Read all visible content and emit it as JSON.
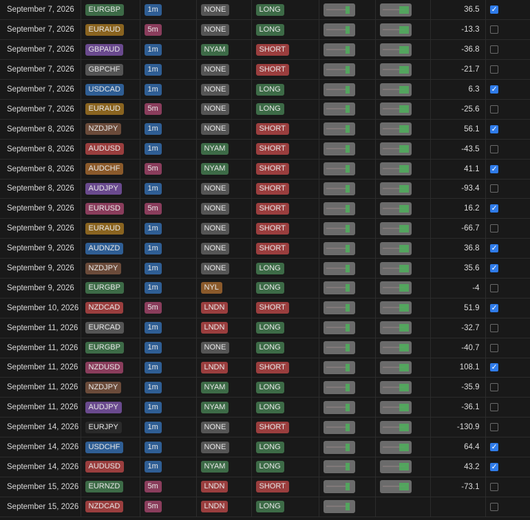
{
  "colors": {
    "EURGBP": "#3d6b47",
    "EURAUD": "#8a6420",
    "GBPAUD": "#6a4a8e",
    "GBPCHF": "#555555",
    "USDCAD": "#2f5e94",
    "NZDJPY": "#6b4b3a",
    "AUDUSD": "#9a3e3e",
    "AUDCHF": "#8b5a2b",
    "AUDJPY": "#6a4a8e",
    "EURUSD": "#8a3d5c",
    "AUDNZD": "#2f5e94",
    "NZDCAD": "#9a3e3e",
    "EURCAD": "#555555",
    "NZDUSD": "#8a3d5c",
    "EURJPY": "#2a2a2a",
    "USDCHF": "#2f5e94",
    "EURNZD": "#3d6b47",
    "1m": "#2f5e94",
    "5m": "#8a3d5c",
    "NONE": "#555555",
    "NYAM": "#3d6b47",
    "NYL": "#8b5a2b",
    "LNDN": "#9a3e3e",
    "LONG": "#3d6b47",
    "SHORT": "#9a3e3e"
  },
  "rows": [
    {
      "date": "September 7, 2026",
      "pair": "EURGBP",
      "tf": "1m",
      "session": "NONE",
      "dir": "LONG",
      "value": "36.5",
      "checked": true,
      "has_exit": true
    },
    {
      "date": "September 7, 2026",
      "pair": "EURAUD",
      "tf": "5m",
      "session": "NONE",
      "dir": "LONG",
      "value": "-13.3",
      "checked": false,
      "has_exit": true
    },
    {
      "date": "September 7, 2026",
      "pair": "GBPAUD",
      "tf": "1m",
      "session": "NYAM",
      "dir": "SHORT",
      "value": "-36.8",
      "checked": false,
      "has_exit": true
    },
    {
      "date": "September 7, 2026",
      "pair": "GBPCHF",
      "tf": "1m",
      "session": "NONE",
      "dir": "SHORT",
      "value": "-21.7",
      "checked": false,
      "has_exit": true
    },
    {
      "date": "September 7, 2026",
      "pair": "USDCAD",
      "tf": "1m",
      "session": "NONE",
      "dir": "LONG",
      "value": "6.3",
      "checked": true,
      "has_exit": true
    },
    {
      "date": "September 7, 2026",
      "pair": "EURAUD",
      "tf": "5m",
      "session": "NONE",
      "dir": "LONG",
      "value": "-25.6",
      "checked": false,
      "has_exit": true
    },
    {
      "date": "September 8, 2026",
      "pair": "NZDJPY",
      "tf": "1m",
      "session": "NONE",
      "dir": "SHORT",
      "value": "56.1",
      "checked": true,
      "has_exit": true
    },
    {
      "date": "September 8, 2026",
      "pair": "AUDUSD",
      "tf": "1m",
      "session": "NYAM",
      "dir": "SHORT",
      "value": "-43.5",
      "checked": false,
      "has_exit": true
    },
    {
      "date": "September 8, 2026",
      "pair": "AUDCHF",
      "tf": "5m",
      "session": "NYAM",
      "dir": "SHORT",
      "value": "41.1",
      "checked": true,
      "has_exit": true
    },
    {
      "date": "September 8, 2026",
      "pair": "AUDJPY",
      "tf": "1m",
      "session": "NONE",
      "dir": "SHORT",
      "value": "-93.4",
      "checked": false,
      "has_exit": true
    },
    {
      "date": "September 9, 2026",
      "pair": "EURUSD",
      "tf": "5m",
      "session": "NONE",
      "dir": "SHORT",
      "value": "16.2",
      "checked": true,
      "has_exit": true
    },
    {
      "date": "September 9, 2026",
      "pair": "EURAUD",
      "tf": "1m",
      "session": "NONE",
      "dir": "SHORT",
      "value": "-66.7",
      "checked": false,
      "has_exit": true
    },
    {
      "date": "September 9, 2026",
      "pair": "AUDNZD",
      "tf": "1m",
      "session": "NONE",
      "dir": "SHORT",
      "value": "36.8",
      "checked": true,
      "has_exit": true
    },
    {
      "date": "September 9, 2026",
      "pair": "NZDJPY",
      "tf": "1m",
      "session": "NONE",
      "dir": "LONG",
      "value": "35.6",
      "checked": true,
      "has_exit": true
    },
    {
      "date": "September 9, 2026",
      "pair": "EURGBP",
      "tf": "1m",
      "session": "NYL",
      "dir": "LONG",
      "value": "-4",
      "checked": false,
      "has_exit": true
    },
    {
      "date": "September 10, 2026",
      "pair": "NZDCAD",
      "tf": "5m",
      "session": "LNDN",
      "dir": "SHORT",
      "value": "51.9",
      "checked": true,
      "has_exit": true
    },
    {
      "date": "September 11, 2026",
      "pair": "EURCAD",
      "tf": "1m",
      "session": "LNDN",
      "dir": "LONG",
      "value": "-32.7",
      "checked": false,
      "has_exit": true
    },
    {
      "date": "September 11, 2026",
      "pair": "EURGBP",
      "tf": "1m",
      "session": "NONE",
      "dir": "LONG",
      "value": "-40.7",
      "checked": false,
      "has_exit": true
    },
    {
      "date": "September 11, 2026",
      "pair": "NZDUSD",
      "tf": "1m",
      "session": "LNDN",
      "dir": "SHORT",
      "value": "108.1",
      "checked": true,
      "has_exit": true
    },
    {
      "date": "September 11, 2026",
      "pair": "NZDJPY",
      "tf": "1m",
      "session": "NYAM",
      "dir": "LONG",
      "value": "-35.9",
      "checked": false,
      "has_exit": true
    },
    {
      "date": "September 11, 2026",
      "pair": "AUDJPY",
      "tf": "1m",
      "session": "NYAM",
      "dir": "LONG",
      "value": "-36.1",
      "checked": false,
      "has_exit": true
    },
    {
      "date": "September 14, 2026",
      "pair": "EURJPY",
      "tf": "1m",
      "session": "NONE",
      "dir": "SHORT",
      "value": "-130.9",
      "checked": false,
      "has_exit": true
    },
    {
      "date": "September 14, 2026",
      "pair": "USDCHF",
      "tf": "1m",
      "session": "NONE",
      "dir": "LONG",
      "value": "64.4",
      "checked": true,
      "has_exit": true
    },
    {
      "date": "September 14, 2026",
      "pair": "AUDUSD",
      "tf": "1m",
      "session": "NYAM",
      "dir": "LONG",
      "value": "43.2",
      "checked": true,
      "has_exit": true
    },
    {
      "date": "September 15, 2026",
      "pair": "EURNZD",
      "tf": "5m",
      "session": "LNDN",
      "dir": "SHORT",
      "value": "-73.1",
      "checked": false,
      "has_exit": true
    },
    {
      "date": "September 15, 2026",
      "pair": "NZDCAD",
      "tf": "5m",
      "session": "LNDN",
      "dir": "LONG",
      "value": "",
      "checked": false,
      "has_exit": false
    }
  ]
}
